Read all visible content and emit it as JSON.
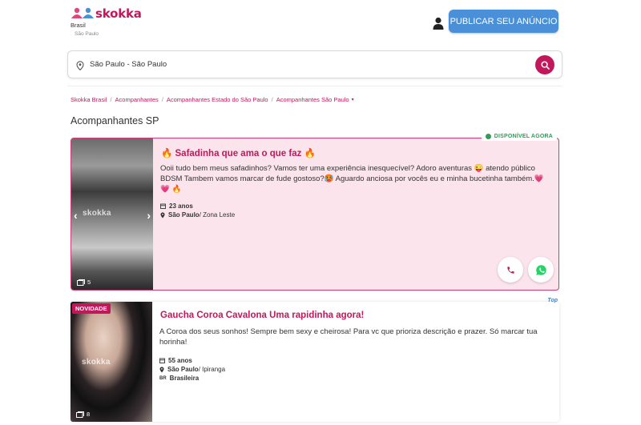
{
  "header": {
    "logo_text": "skokka",
    "country": "Brasil",
    "city": "São Paulo",
    "publish_button": "PUBLICAR SEU ANÚNCIO",
    "icons": [
      "skokka-logo-icon",
      "user-icon"
    ]
  },
  "search": {
    "value": "São Paulo - São Paulo",
    "icons": [
      "location-pin-icon",
      "search-icon"
    ]
  },
  "breadcrumb": [
    "Skokka Brasil",
    "Acompanhantes",
    "Acompanhantes Estado do São Paulo",
    "Acompanhantes São Paulo"
  ],
  "page_title": "Acompanhantes SP",
  "listings": [
    {
      "title": "🔥 Safadinha que ama o que faz 🔥",
      "description": "Ooii tudo bem meus safadinhos? Vamos ter uma experiência inesquecível? Adoro aventuras 😜 atendo público BDSM Tambem vamos marcar de fude gostoso?🥵 Aguardo anciosa por vocês eu e minha bucetinha também.💗 💗 🔥",
      "age": "23 anos",
      "city": "São Paulo",
      "zone": "/ Zona Leste",
      "photo_count": "5",
      "badge": "DISPONÍVEL AGORA",
      "watermark": "skokka"
    },
    {
      "title": "Gaucha Coroa Cavalona Uma rapidinha agora!",
      "description": "A Coroa dos seus sonhos! Sempre bem sexy e cheirosa! Para vc que prioriza descrição e prazer. Só marcar tua horinha!",
      "age": "55 anos",
      "city": "São Paulo",
      "zone": "/ Ipiranga",
      "nationality_code": "BR",
      "nationality": "Brasileira",
      "photo_count": "8",
      "badge": "NOVIDADE",
      "top_badge": "Top",
      "watermark": "skokka"
    }
  ],
  "colors": {
    "brand": "#c2185b",
    "publish_button": "#4a90d9",
    "available": "#2e9e57",
    "card_highlight": "#fbe4ec"
  }
}
